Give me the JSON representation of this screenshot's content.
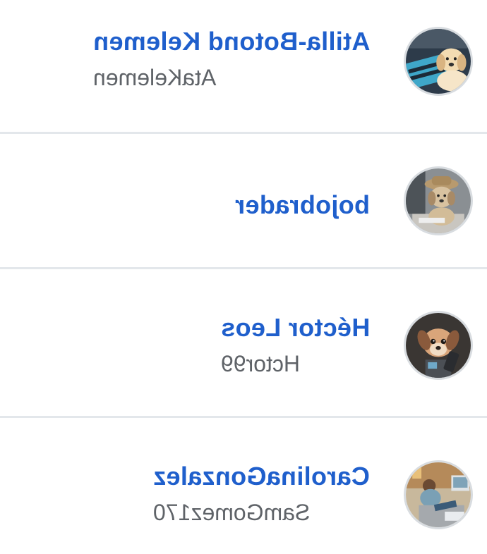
{
  "users": [
    {
      "name": "Atilla-Botond Kelemen",
      "username": "AtaKelemen",
      "avatar_icon": "puppy-at-keyboard-avatar-icon"
    },
    {
      "name": "bojobrader",
      "username": "",
      "avatar_icon": "puppy-with-hat-at-computer-avatar-icon"
    },
    {
      "name": "Héctor Leos",
      "username": "Hctor99",
      "avatar_icon": "puppy-portrait-avatar-icon"
    },
    {
      "name": "CarolinaGonzalez",
      "username": "SamGomez170",
      "avatar_icon": "person-at-desk-avatar-icon"
    }
  ],
  "colors": {
    "name": "#1f5fcc",
    "username": "#5f6368",
    "divider": "#e3e7eb"
  }
}
